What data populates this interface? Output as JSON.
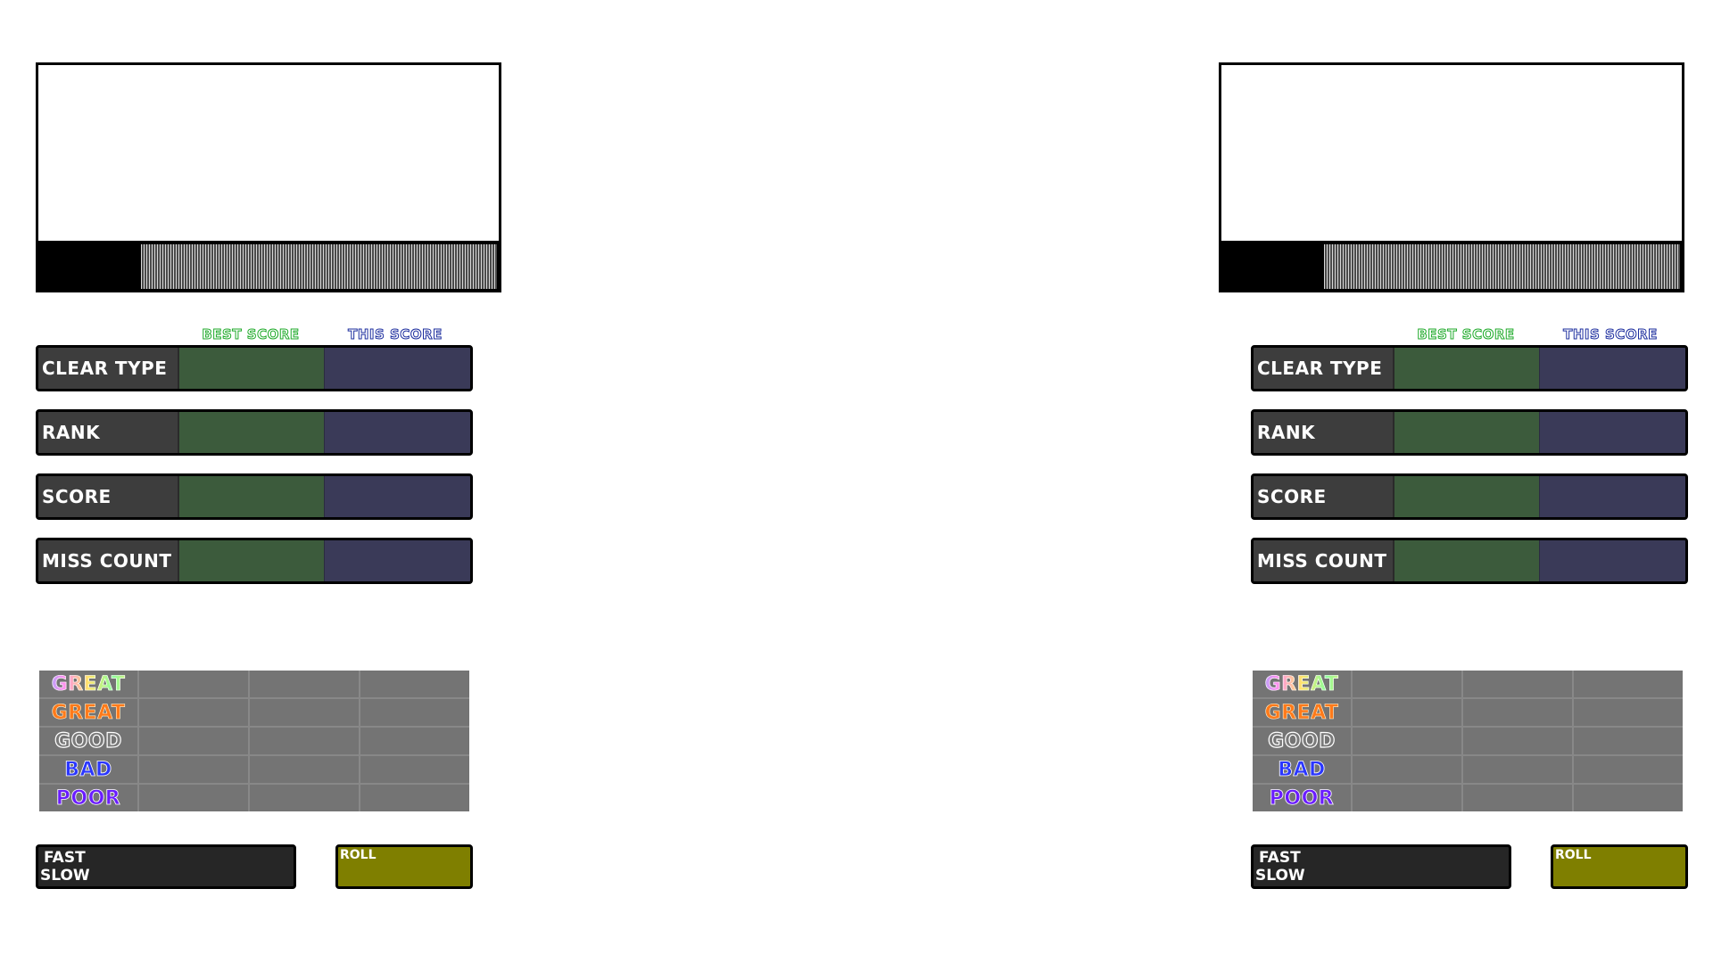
{
  "headers": {
    "best_score": "BEST SCORE",
    "this_score": "THIS SCORE"
  },
  "stats": {
    "clear_type": "CLEAR TYPE",
    "rank": "RANK",
    "score": "SCORE",
    "miss_count": "MISS COUNT"
  },
  "judges": {
    "pgreat": "GREAT",
    "great": "GREAT",
    "good": "GOOD",
    "bad": "BAD",
    "poor": "POOR"
  },
  "timing": {
    "fast": "FAST",
    "slow": "SLOW",
    "roll": "ROLL"
  },
  "colors": {
    "best_column": "#3c5b3c",
    "this_column": "#3a3a58",
    "label_column": "#3d3d3d",
    "judge_table": "#747474",
    "roll_box": "#7f7f00",
    "fast_slow_box": "#262626"
  }
}
